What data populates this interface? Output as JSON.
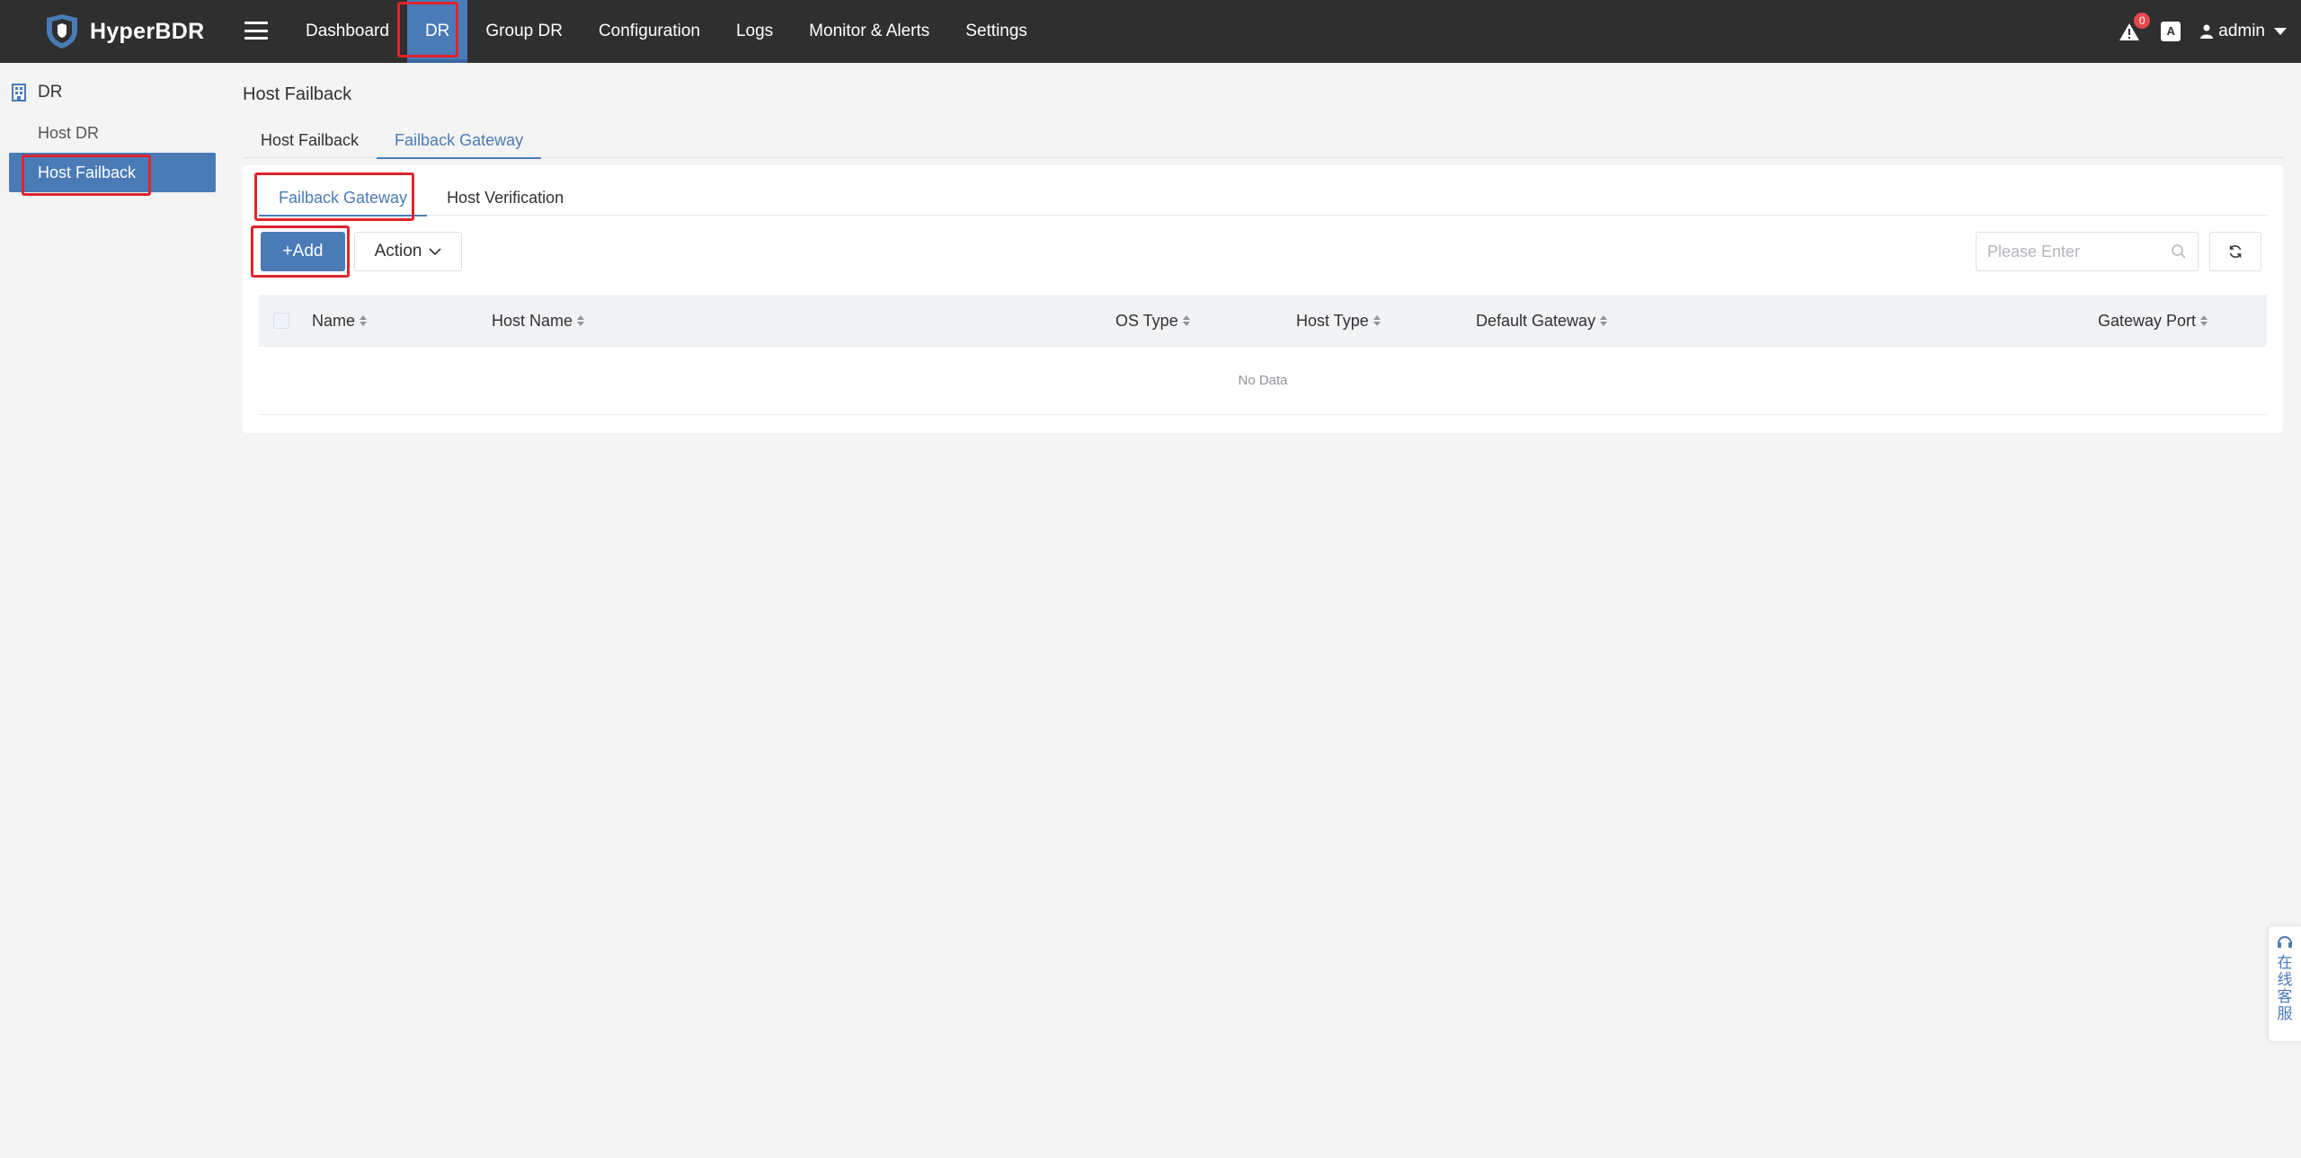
{
  "brand": {
    "name": "HyperBDR"
  },
  "nav": {
    "items": [
      {
        "label": "Dashboard",
        "active": false
      },
      {
        "label": "DR",
        "active": true
      },
      {
        "label": "Group DR",
        "active": false
      },
      {
        "label": "Configuration",
        "active": false
      },
      {
        "label": "Logs",
        "active": false
      },
      {
        "label": "Monitor & Alerts",
        "active": false
      },
      {
        "label": "Settings",
        "active": false
      }
    ]
  },
  "topright": {
    "alert_count": "0",
    "lang_icon": "A",
    "user": "admin"
  },
  "sidebar": {
    "section": "DR",
    "items": [
      {
        "label": "Host DR",
        "active": false
      },
      {
        "label": "Host Failback",
        "active": true
      }
    ]
  },
  "page": {
    "title": "Host Failback",
    "outer_tabs": [
      {
        "label": "Host Failback",
        "active": false
      },
      {
        "label": "Failback Gateway",
        "active": true
      }
    ],
    "inner_tabs": [
      {
        "label": "Failback Gateway",
        "active": true
      },
      {
        "label": "Host Verification",
        "active": false
      }
    ]
  },
  "toolbar": {
    "add_label": "+Add",
    "action_label": "Action",
    "search_placeholder": "Please Enter",
    "search_value": ""
  },
  "table": {
    "columns": [
      "Name",
      "Host Name",
      "OS Type",
      "Host Type",
      "Default Gateway",
      "Gateway Port"
    ],
    "rows": [],
    "empty_text": "No Data"
  },
  "widget": {
    "text": "在线客服"
  },
  "colors": {
    "accent": "#4a7bb7",
    "topbar": "#2f2f2f",
    "highlight": "#e0242c"
  }
}
